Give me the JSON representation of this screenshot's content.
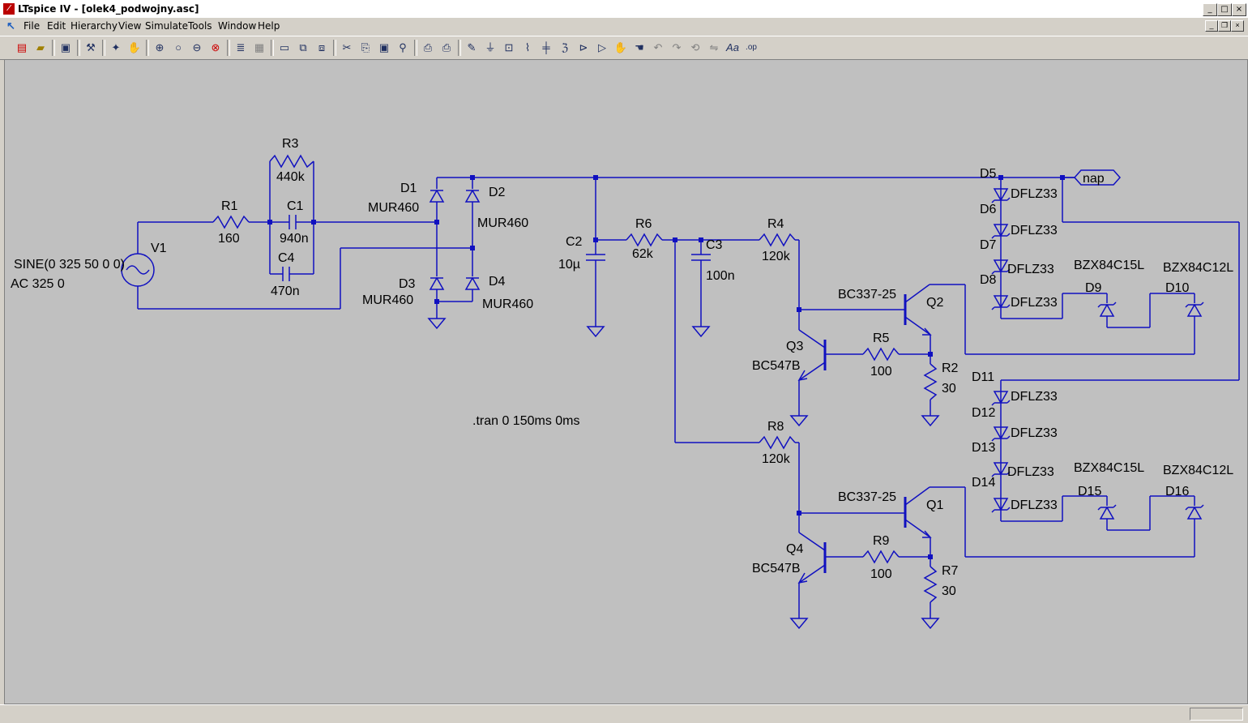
{
  "window": {
    "title": "LTspice IV - [olek4_podwojny.asc]",
    "app_icon": "ltspice-logo-icon"
  },
  "menu": [
    "File",
    "Edit",
    "Hierarchy",
    "View",
    "Simulate",
    "Tools",
    "Window",
    "Help"
  ],
  "toolbar": [
    "new-schematic-icon",
    "open-icon",
    "save-icon",
    "control-panel-icon",
    "run-icon",
    "halt-icon",
    "zoom-in-icon",
    "zoom-pan-icon",
    "zoom-out-icon",
    "zoom-fit-icon",
    "autorange-icon",
    "waveform-icon",
    "tile-horizontal-icon",
    "cascade-icon",
    "tile-vertical-icon",
    "cut-icon",
    "copy-icon",
    "paste-icon",
    "find-icon",
    "print-preview-icon",
    "print-icon",
    "draw-wire-icon",
    "ground-icon",
    "label-net-icon",
    "resistor-icon",
    "capacitor-icon",
    "inductor-icon",
    "diode-icon",
    "component-icon",
    "move-icon",
    "drag-icon",
    "undo-icon",
    "redo-icon",
    "rotate-icon",
    "mirror-icon",
    "text-icon",
    "spice-directive-icon"
  ],
  "schematic": {
    "wire_color": "#1010c0",
    "background": "#c0c0c0",
    "source": {
      "name": "V1",
      "value": "SINE(0 325 50 0 0)",
      "ac": "AC 325 0"
    },
    "resistors": {
      "R1": {
        "name": "R1",
        "value": "160"
      },
      "R3": {
        "name": "R3",
        "value": "440k"
      },
      "R6": {
        "name": "R6",
        "value": "62k"
      },
      "R4": {
        "name": "R4",
        "value": "120k"
      },
      "R5": {
        "name": "R5",
        "value": "100"
      },
      "R2": {
        "name": "R2",
        "value": "30"
      },
      "R8": {
        "name": "R8",
        "value": "120k"
      },
      "R9": {
        "name": "R9",
        "value": "100"
      },
      "R7": {
        "name": "R7",
        "value": "30"
      }
    },
    "capacitors": {
      "C1": {
        "name": "C1",
        "value": "940n"
      },
      "C4": {
        "name": "C4",
        "value": "470n"
      },
      "C2": {
        "name": "C2",
        "value": "10µ"
      },
      "C3": {
        "name": "C3",
        "value": "100n"
      }
    },
    "rectifier": {
      "D1": {
        "name": "D1",
        "value": "MUR460"
      },
      "D2": {
        "name": "D2",
        "value": "MUR460"
      },
      "D3": {
        "name": "D3",
        "value": "MUR460"
      },
      "D4": {
        "name": "D4",
        "value": "MUR460"
      }
    },
    "zeners_top": [
      "D5",
      "D6",
      "D7",
      "D8"
    ],
    "zeners_bottom": [
      "D11",
      "D12",
      "D13",
      "D14"
    ],
    "zener_value": "DFLZ33",
    "d9": {
      "name": "D9",
      "value": "BZX84C15L"
    },
    "d10": {
      "name": "D10",
      "value": "BZX84C12L"
    },
    "d15": {
      "name": "D15",
      "value": "BZX84C15L"
    },
    "d16": {
      "name": "D16",
      "value": "BZX84C12L"
    },
    "transistors": {
      "Q2": {
        "name": "Q2",
        "value": "BC337-25"
      },
      "Q3": {
        "name": "Q3",
        "value": "BC547B"
      },
      "Q1": {
        "name": "Q1",
        "value": "BC337-25"
      },
      "Q4": {
        "name": "Q4",
        "value": "BC547B"
      }
    },
    "net_label": "nap",
    "directive": ".tran 0 150ms 0ms"
  }
}
